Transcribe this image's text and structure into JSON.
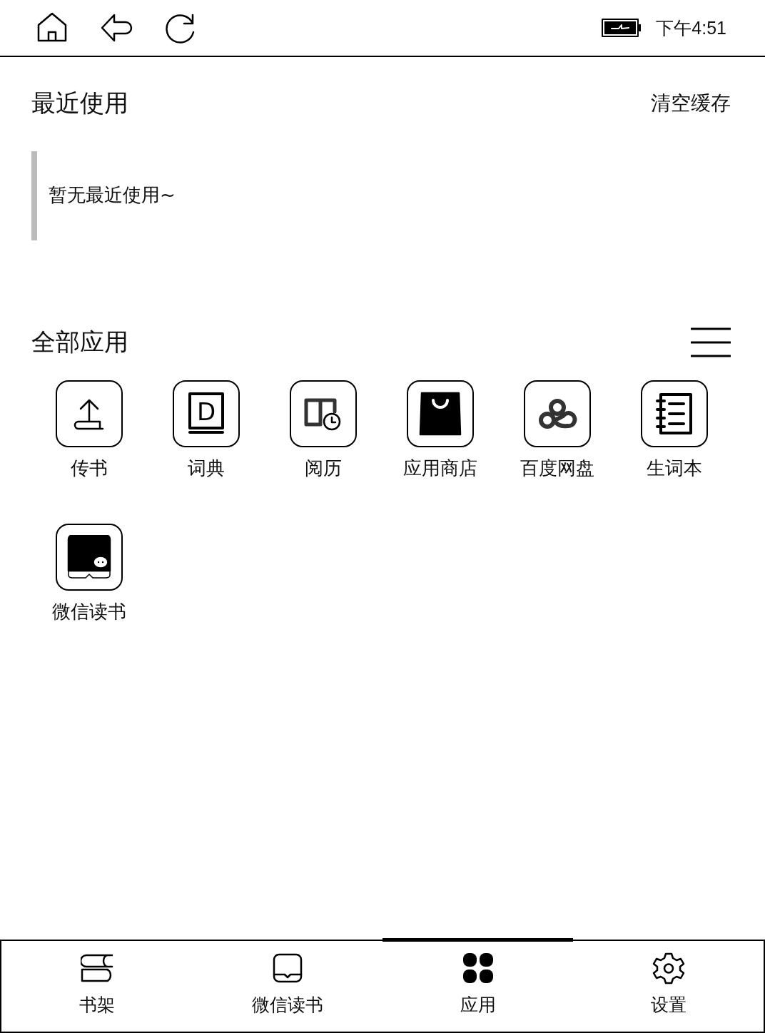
{
  "status_bar": {
    "time": "下午4:51",
    "charging": true
  },
  "recent": {
    "title": "最近使用",
    "action": "清空缓存",
    "empty_text": "暂无最近使用~"
  },
  "apps": {
    "title": "全部应用",
    "items": [
      {
        "label": "传书"
      },
      {
        "label": "词典",
        "icon_letter": "D"
      },
      {
        "label": "阅历"
      },
      {
        "label": "应用商店"
      },
      {
        "label": "百度网盘"
      },
      {
        "label": "生词本"
      },
      {
        "label": "微信读书"
      }
    ]
  },
  "tabs": [
    {
      "label": "书架",
      "selected": false
    },
    {
      "label": "微信读书",
      "selected": false
    },
    {
      "label": "应用",
      "selected": true
    },
    {
      "label": "设置",
      "selected": false
    }
  ]
}
